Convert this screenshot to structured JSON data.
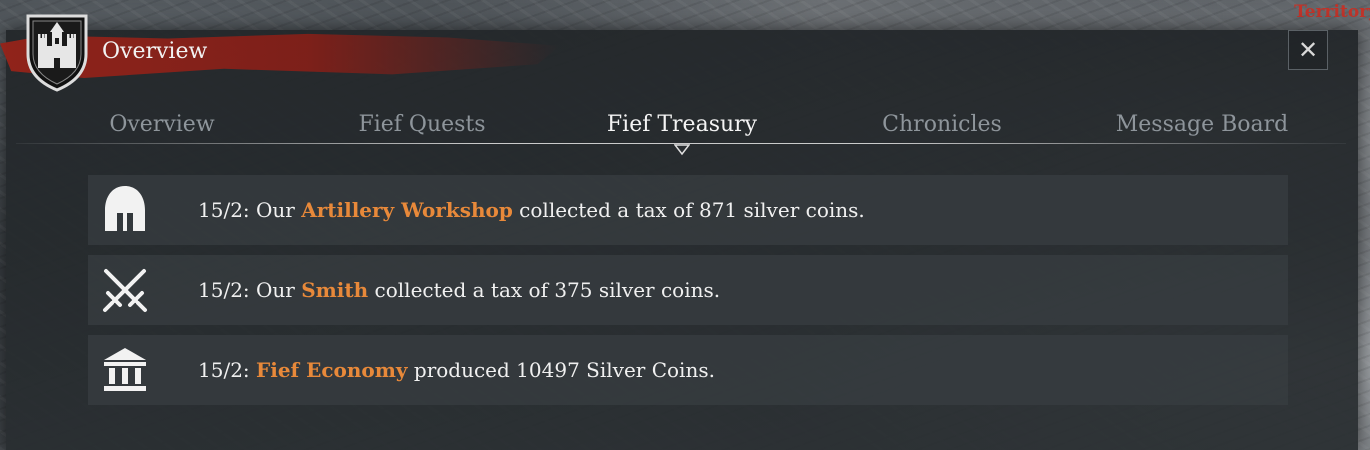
{
  "territory_label": "Territory",
  "panel": {
    "title": "Overview",
    "close_label": "✕"
  },
  "tabs": [
    {
      "label": "Overview",
      "active": false
    },
    {
      "label": "Fief Quests",
      "active": false
    },
    {
      "label": "Fief Treasury",
      "active": true
    },
    {
      "label": "Chronicles",
      "active": false
    },
    {
      "label": "Message Board",
      "active": false
    }
  ],
  "entries": [
    {
      "icon": "helmet-icon",
      "prefix": "15/2: Our ",
      "highlight": "Artillery Workshop",
      "suffix": " collected a tax of 871 silver coins."
    },
    {
      "icon": "crossed-swords-icon",
      "prefix": "15/2: Our ",
      "highlight": "Smith",
      "suffix": " collected a tax of 375 silver coins."
    },
    {
      "icon": "bank-icon",
      "prefix": "15/2: ",
      "highlight": "Fief Economy",
      "suffix": " produced 10497 Silver Coins."
    }
  ],
  "colors": {
    "highlight": "#e8893a",
    "header_stroke": "#962319",
    "territory": "#c0342a"
  }
}
